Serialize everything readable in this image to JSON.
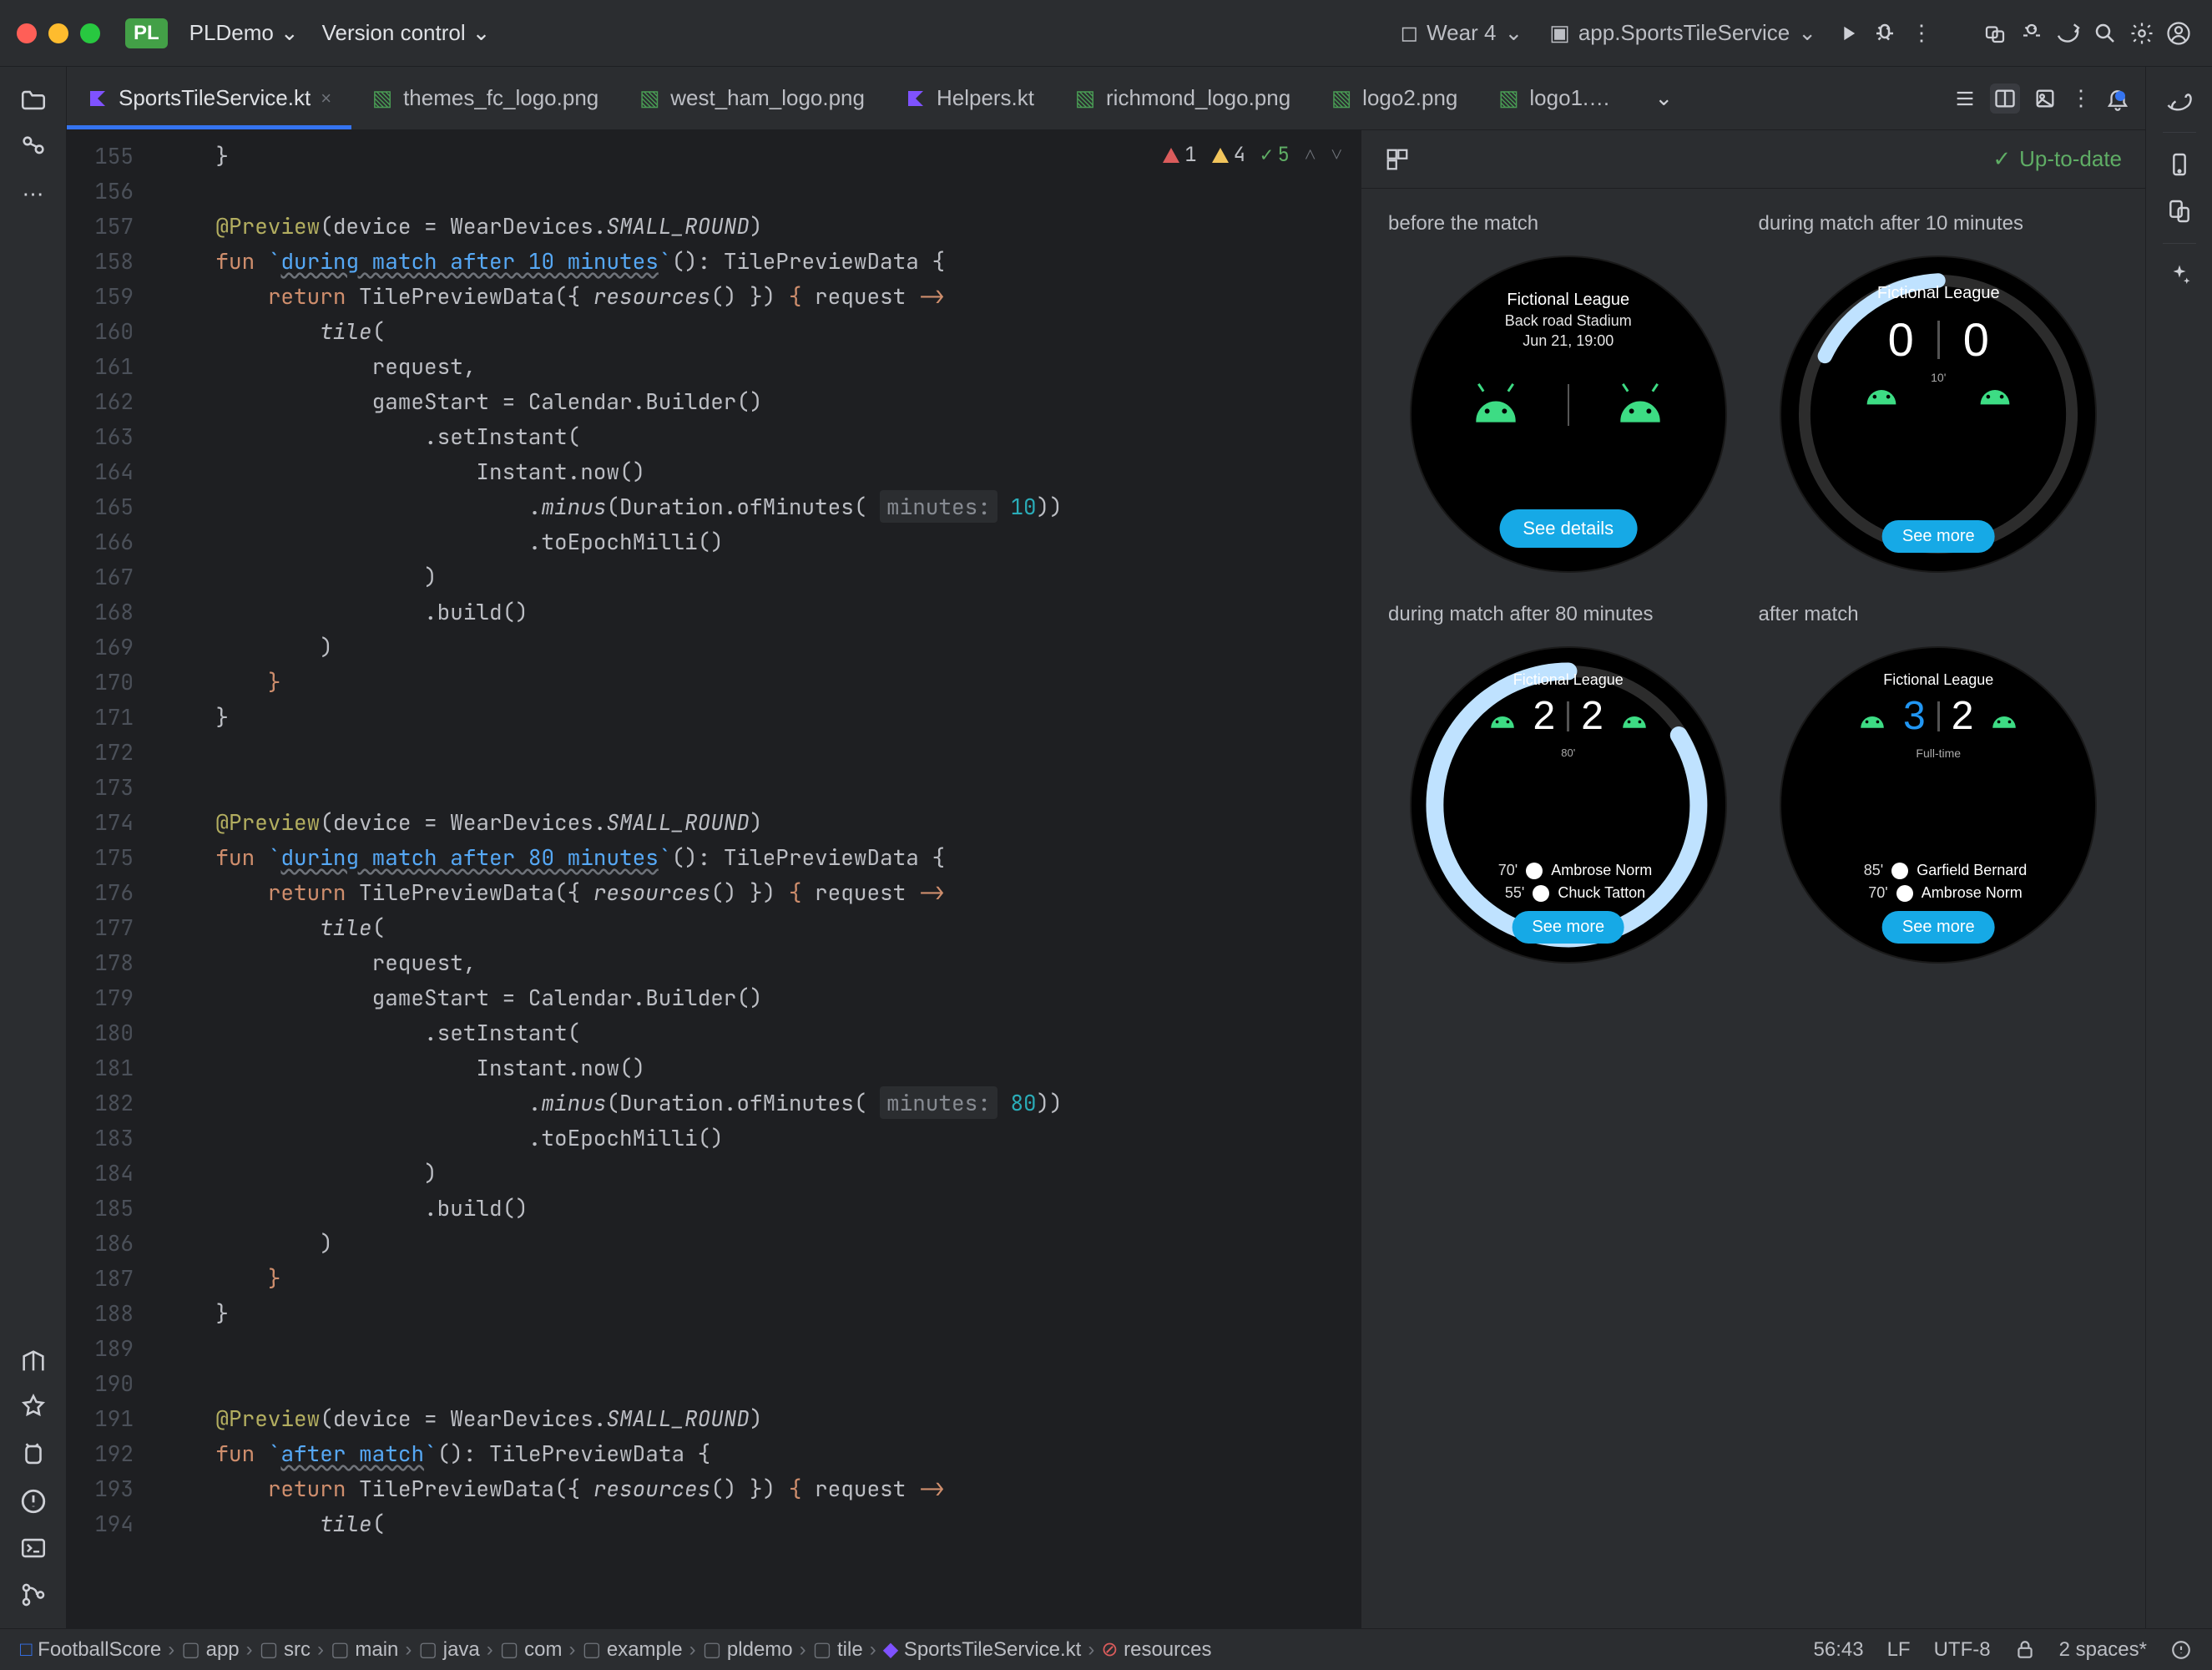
{
  "titlebar": {
    "project_badge": "PL",
    "project_name": "PLDemo",
    "vcs": "Version control",
    "device": "Wear 4",
    "run_config": "app.SportsTileService"
  },
  "tabs": [
    {
      "label": "SportsTileService.kt",
      "type": "kt",
      "active": true,
      "closeable": true
    },
    {
      "label": "themes_fc_logo.png",
      "type": "img"
    },
    {
      "label": "west_ham_logo.png",
      "type": "img"
    },
    {
      "label": "Helpers.kt",
      "type": "kt"
    },
    {
      "label": "richmond_logo.png",
      "type": "img"
    },
    {
      "label": "logo2.png",
      "type": "img"
    },
    {
      "label": "logo1.png",
      "type": "img",
      "trunc": true
    }
  ],
  "analysis": {
    "errors": "1",
    "warnings": "4",
    "ok": "5"
  },
  "gutter_start": 155,
  "gutter_end": 194,
  "code_lines": [
    "    }",
    "",
    "    <ann>@Preview</ann>(device = WearDevices.<it>SMALL_ROUND</it>)",
    "    <kw>fun</kw> <fn>`<u>during match after 10 minutes</u>`</fn>(): TilePreviewData {",
    "        <kw>return</kw> TilePreviewData({ <it>resources</it>() }) <kw>{</kw> request <kw>-></kw>",
    "            <it>tile</it>(",
    "                request,",
    "                gameStart = Calendar.Builder()",
    "                    .setInstant(",
    "                        Instant.now()",
    "                            .<it>minus</it>(Duration.ofMinutes( <hint>minutes:</hint> <num>10</num>))",
    "                            .toEpochMilli()",
    "                    )",
    "                    .build()",
    "            )",
    "        <kw>}</kw>",
    "    }",
    "",
    "",
    "    <ann>@Preview</ann>(device = WearDevices.<it>SMALL_ROUND</it>)",
    "    <kw>fun</kw> <fn>`<u>during match after 80 minutes</u>`</fn>(): TilePreviewData {",
    "        <kw>return</kw> TilePreviewData({ <it>resources</it>() }) <kw>{</kw> request <kw>-></kw>",
    "            <it>tile</it>(",
    "                request,",
    "                gameStart = Calendar.Builder()",
    "                    .setInstant(",
    "                        Instant.now()",
    "                            .<it>minus</it>(Duration.ofMinutes( <hint>minutes:</hint> <num>80</num>))",
    "                            .toEpochMilli()",
    "                    )",
    "                    .build()",
    "            )",
    "        <kw>}</kw>",
    "    }",
    "",
    "",
    "    <ann>@Preview</ann>(device = WearDevices.<it>SMALL_ROUND</it>)",
    "    <kw>fun</kw> <fn>`<u>after match</u>`</fn>(): TilePreviewData {",
    "        <kw>return</kw> TilePreviewData({ <it>resources</it>() }) <kw>{</kw> request <kw>-></kw>",
    "            <it>tile</it>("
  ],
  "preview": {
    "status": "Up-to-date",
    "tiles": [
      {
        "label": "before the match",
        "league": "Fictional League",
        "sub1": "Back road Stadium",
        "sub2": "Jun 21, 19:00",
        "button": "See details"
      },
      {
        "label": "during match after 10 minutes",
        "league": "Fictional League",
        "score_home": "0",
        "score_away": "0",
        "elapsed": "10'",
        "button": "See more"
      },
      {
        "label": "during match after 80 minutes",
        "league": "Fictional League",
        "score_home": "2",
        "score_away": "2",
        "elapsed": "80'",
        "events": [
          {
            "t": "70'",
            "name": "Ambrose Norm"
          },
          {
            "t": "55'",
            "name": "Chuck Tatton"
          }
        ],
        "button": "See more"
      },
      {
        "label": "after match",
        "league": "Fictional League",
        "score_home": "3",
        "score_away": "2",
        "elapsed": "Full-time",
        "events": [
          {
            "t": "85'",
            "name": "Garfield Bernard"
          },
          {
            "t": "70'",
            "name": "Ambrose Norm"
          }
        ],
        "button": "See more"
      }
    ]
  },
  "breadcrumbs": [
    "FootballScore",
    "app",
    "src",
    "main",
    "java",
    "com",
    "example",
    "pldemo",
    "tile",
    "SportsTileService.kt",
    "resources"
  ],
  "status": {
    "caret": "56:43",
    "le": "LF",
    "enc": "UTF-8",
    "indent": "2 spaces*"
  }
}
